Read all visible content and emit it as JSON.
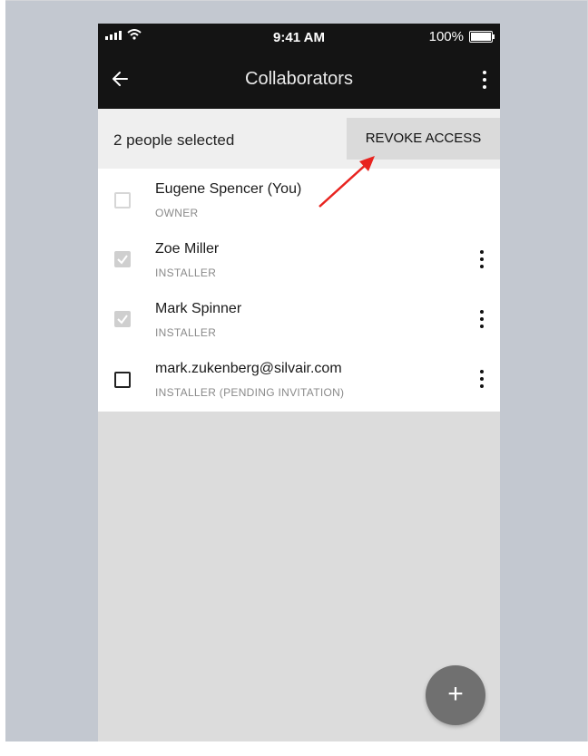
{
  "status_bar": {
    "time": "9:41 AM",
    "battery": "100%"
  },
  "app_bar": {
    "title": "Collaborators"
  },
  "selection_bar": {
    "count_text": "2 people selected",
    "revoke_label": "REVOKE ACCESS"
  },
  "collaborators": [
    {
      "name": "Eugene Spencer (You)",
      "role": "OWNER",
      "checkbox": "unchecked-disabled",
      "has_menu": false
    },
    {
      "name": "Zoe Miller",
      "role": "INSTALLER",
      "checkbox": "checked-disabled",
      "has_menu": true
    },
    {
      "name": "Mark Spinner",
      "role": "INSTALLER",
      "checkbox": "checked-disabled",
      "has_menu": true
    },
    {
      "name": "mark.zukenberg@silvair.com",
      "role": "INSTALLER (PENDING INVITATION)",
      "checkbox": "unchecked",
      "has_menu": true
    }
  ],
  "fab": {
    "label": "+"
  },
  "colors": {
    "app_bar": "#141414",
    "annotation_arrow": "#e8231f",
    "fab": "#707070"
  }
}
